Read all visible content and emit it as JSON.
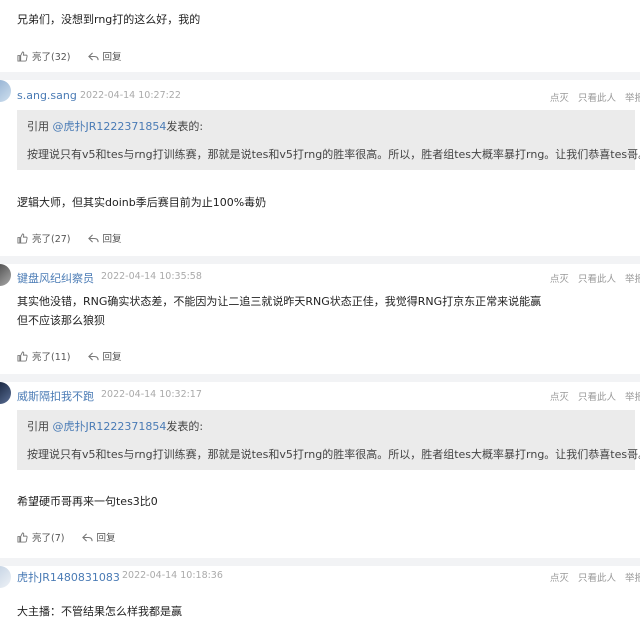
{
  "posts": [
    {
      "text": "兄弟们，没想到rng打的这么好，我的",
      "likes": "亮了(32)",
      "reply": "回复"
    },
    {
      "user": "s.ang.sang",
      "time": "2022-04-14 10:27:22",
      "quote_prefix": "引用 ",
      "quote_user": "@虎扑JR1222371854",
      "quote_suffix": "发表的:",
      "quote_text": "按理说只有v5和tes与rng打训练赛，那就是说tes和v5打rng的胜率很高。所以，胜者组tes大概率暴打rng。让我们恭喜tes哥。",
      "text": "逻辑大师，但其实doinb季后赛目前为止100%毒奶",
      "likes": "亮了(27)",
      "reply": "回复"
    },
    {
      "user": "键盘风纪纠察员",
      "time": "2022-04-14 10:35:58",
      "text1": "其实他没错，RNG确实状态差，不能因为让二追三就说昨天RNG状态正佳，我觉得RNG打京东正常来说能赢",
      "text2": "但不应该那么狼狈",
      "likes": "亮了(11)",
      "reply": "回复"
    },
    {
      "user": "威斯隔扣我不跑",
      "time": "2022-04-14 10:32:17",
      "quote_prefix": "引用 ",
      "quote_user": "@虎扑JR1222371854",
      "quote_suffix": "发表的:",
      "quote_text": "按理说只有v5和tes与rng打训练赛，那就是说tes和v5打rng的胜率很高。所以，胜者组tes大概率暴打rng。让我们恭喜tes哥。",
      "text": "希望硬币哥再来一句tes3比0",
      "likes": "亮了(7)",
      "reply": "回复"
    },
    {
      "user": "虎扑JR1480831083",
      "time": "2022-04-14 10:18:36",
      "text": "大主播：不管结果怎么样我都是赢"
    }
  ],
  "actions": {
    "dislike": "点灭",
    "only_author": "只看此人",
    "report": "举报"
  },
  "colors": {
    "link": "#4a7bb5",
    "quote_bg": "#ebebeb",
    "separator": "#f2f3f5"
  },
  "icons": {
    "like": "thumbs-up-icon",
    "reply": "reply-arrow-icon"
  }
}
